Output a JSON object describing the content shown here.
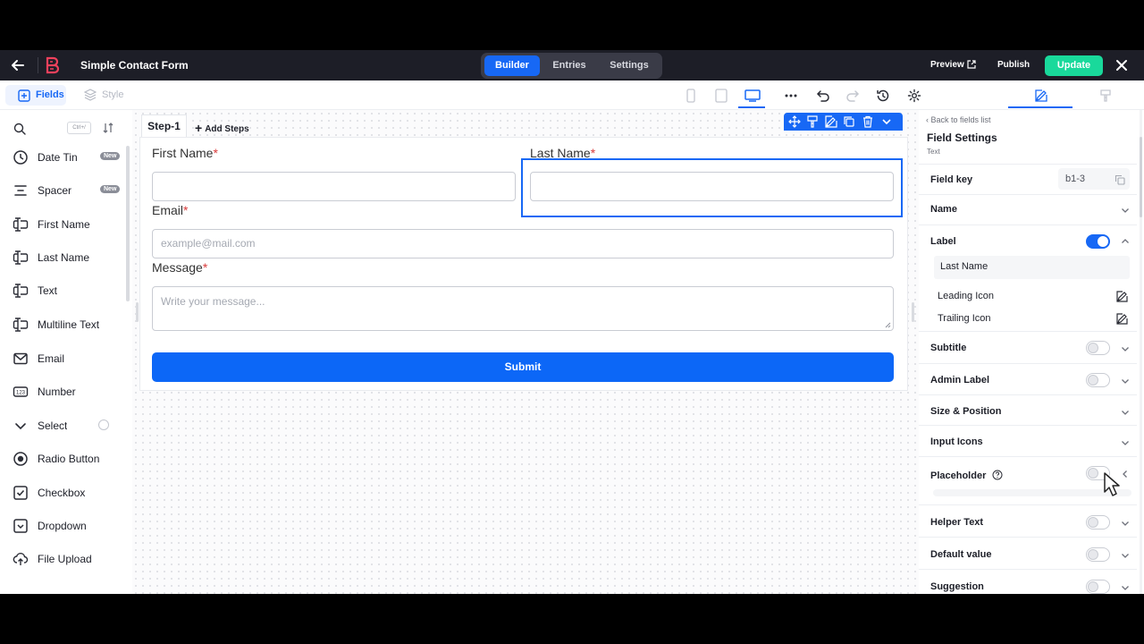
{
  "topbar": {
    "title": "Simple Contact Form",
    "tabs": [
      {
        "label": "Builder",
        "active": true
      },
      {
        "label": "Entries",
        "active": false
      },
      {
        "label": "Settings",
        "active": false
      }
    ],
    "preview_label": "Preview",
    "publish_label": "Publish",
    "update_label": "Update",
    "accent_color": "#1768f5",
    "update_color": "#19d99b"
  },
  "subbar": {
    "fields_label": "Fields",
    "style_label": "Style",
    "active_device": "desktop"
  },
  "sidebar": {
    "search_shortcut": "Ctrl+/",
    "items": [
      {
        "label": "Date Tin",
        "icon": "clock-icon",
        "badge": "New"
      },
      {
        "label": "Spacer",
        "icon": "spacer-icon",
        "badge": "New"
      },
      {
        "label": "First Name",
        "icon": "text-field-icon"
      },
      {
        "label": "Last Name",
        "icon": "text-field-icon"
      },
      {
        "label": "Text",
        "icon": "text-field-icon"
      },
      {
        "label": "Multiline Text",
        "icon": "text-field-icon"
      },
      {
        "label": "Email",
        "icon": "mail-icon"
      },
      {
        "label": "Number",
        "icon": "number-icon"
      },
      {
        "label": "Select",
        "icon": "chevron-down-icon"
      },
      {
        "label": "Radio Button",
        "icon": "radio-icon"
      },
      {
        "label": "Checkbox",
        "icon": "checkbox-icon"
      },
      {
        "label": "Dropdown",
        "icon": "dropdown-icon"
      },
      {
        "label": "File Upload",
        "icon": "upload-icon"
      }
    ]
  },
  "canvas": {
    "step_label": "Step-1",
    "add_steps_label": "Add Steps",
    "fields": {
      "first_name": {
        "label": "First Name",
        "required": "*",
        "value": ""
      },
      "last_name": {
        "label": "Last Name",
        "required": "*",
        "value": ""
      },
      "email": {
        "label": "Email",
        "required": "*",
        "placeholder": "example@mail.com"
      },
      "message": {
        "label": "Message",
        "required": "*",
        "placeholder": "Write your message..."
      }
    },
    "submit_label": "Submit"
  },
  "settings": {
    "back_label": "Back to fields list",
    "title": "Field Settings",
    "subtitle": "Text",
    "field_key_label": "Field key",
    "field_key_value": "b1-3",
    "name_label": "Name",
    "label_label": "Label",
    "label_enabled": true,
    "label_value": "Last Name",
    "leading_icon_label": "Leading Icon",
    "trailing_icon_label": "Trailing Icon",
    "subtitle_label": "Subtitle",
    "subtitle_enabled": false,
    "admin_label_label": "Admin Label",
    "admin_label_enabled": false,
    "size_position_label": "Size & Position",
    "input_icons_label": "Input Icons",
    "placeholder_label": "Placeholder",
    "placeholder_enabled": false,
    "helper_text_label": "Helper Text",
    "helper_text_enabled": false,
    "default_value_label": "Default value",
    "default_value_enabled": false,
    "suggestion_label": "Suggestion",
    "suggestion_enabled": false
  }
}
